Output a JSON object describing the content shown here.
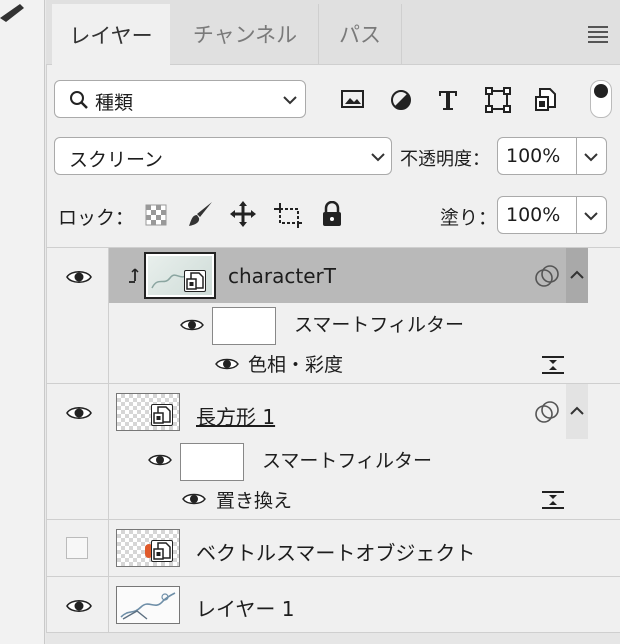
{
  "tabs": [
    {
      "label": "レイヤー",
      "active": true
    },
    {
      "label": "チャンネル",
      "active": false
    },
    {
      "label": "パス",
      "active": false
    }
  ],
  "filter": {
    "kind_label": "種類",
    "icons": [
      "image-filter-icon",
      "adjustment-filter-icon",
      "type-filter-icon",
      "shape-filter-icon",
      "smart-object-filter-icon"
    ]
  },
  "blend": {
    "mode": "スクリーン",
    "opacity_label": "不透明度：",
    "opacity_value": "100%"
  },
  "lock": {
    "label": "ロック：",
    "fill_label": "塗り：",
    "fill_value": "100%"
  },
  "layers": [
    {
      "name": "characterT",
      "visible": true,
      "selected": true,
      "clipped": true
    },
    {
      "name": "スマートフィルター",
      "type": "smart-filter"
    },
    {
      "name": "色相・彩度",
      "type": "filter"
    },
    {
      "name": "長方形 1",
      "visible": true,
      "selected": false
    },
    {
      "name": "スマートフィルター",
      "type": "smart-filter"
    },
    {
      "name": "置き換え",
      "type": "filter"
    },
    {
      "name": "ベクトルスマートオブジェクト",
      "visible": false
    },
    {
      "name": "レイヤー 1",
      "visible": true
    }
  ],
  "colors": {
    "selected_row": "#b9b9b9",
    "panel_bg": "#f0f0f0",
    "accent_dot": "#e05a2b"
  }
}
